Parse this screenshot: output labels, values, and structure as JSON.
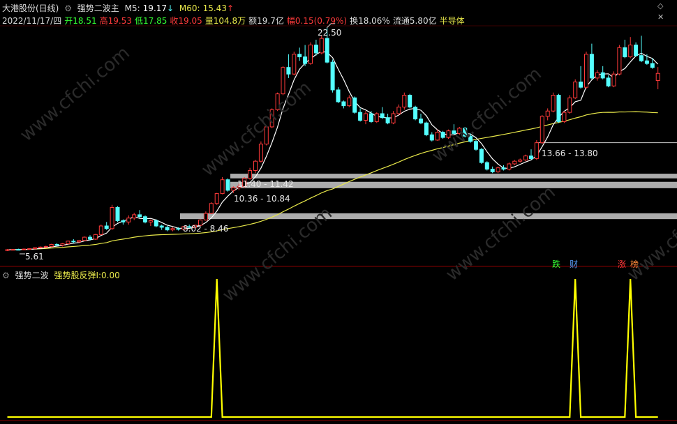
{
  "header": {
    "stock_name": "大港股份(日线)",
    "indicator_name": "强势二波主",
    "m5_label": "M5:",
    "m5_value": "19.17",
    "m5_arrow": "↓",
    "m60_label": "M60:",
    "m60_value": "15.43",
    "m60_arrow": "↑"
  },
  "info": {
    "date": "2022/11/17/四",
    "open_label": "开",
    "open": "18.51",
    "high_label": "高",
    "high": "19.53",
    "low_label": "低",
    "low": "17.85",
    "close_label": "收",
    "close": "19.05",
    "vol_label": "量",
    "vol": "104.8万",
    "amt_label": "额",
    "amt": "19.7亿",
    "chg_label": "幅",
    "chg": "0.15(0.79%)",
    "turn_label": "换",
    "turn": "18.06%",
    "float_label": "流通",
    "float": "5.80亿",
    "sector": "半导体"
  },
  "chart": {
    "high_marker": "22.50",
    "low_marker": "5.61",
    "zones": [
      {
        "label": "13.66 - 13.80"
      },
      {
        "label": "11.40 - 11.42"
      },
      {
        "label": "10.36 - 10.84"
      },
      {
        "label": "8.02 - 8.46"
      }
    ],
    "tags": [
      "跌",
      "财",
      "涨",
      "榜"
    ],
    "watermark": "www.cfchi.com"
  },
  "sub": {
    "name": "强势二波",
    "line_label": "强势股反弹I:",
    "line_value": "0.00"
  },
  "colors": {
    "up": "#ff3a3a",
    "down": "#54ffff",
    "ma5": "#ffffff",
    "ma60": "#e8e84a",
    "signal": "#ffff00"
  },
  "chart_data": {
    "type": "candlestick",
    "ohlc": [
      [
        5.7,
        5.75,
        5.6,
        5.7
      ],
      [
        5.7,
        5.75,
        5.65,
        5.72
      ],
      [
        5.72,
        5.78,
        5.68,
        5.7
      ],
      [
        5.7,
        5.8,
        5.66,
        5.75
      ],
      [
        5.75,
        5.8,
        5.7,
        5.78
      ],
      [
        5.78,
        5.9,
        5.72,
        5.85
      ],
      [
        5.85,
        5.95,
        5.8,
        5.9
      ],
      [
        5.9,
        6.0,
        5.85,
        5.95
      ],
      [
        5.95,
        6.15,
        5.9,
        6.1
      ],
      [
        6.1,
        6.2,
        6.0,
        6.05
      ],
      [
        6.05,
        6.2,
        5.95,
        6.15
      ],
      [
        6.15,
        6.4,
        6.1,
        6.35
      ],
      [
        6.35,
        6.5,
        6.2,
        6.3
      ],
      [
        6.3,
        6.45,
        6.2,
        6.4
      ],
      [
        6.4,
        6.7,
        6.35,
        6.65
      ],
      [
        6.65,
        6.8,
        6.4,
        6.5
      ],
      [
        6.5,
        6.9,
        6.45,
        6.85
      ],
      [
        6.85,
        7.6,
        6.8,
        7.5
      ],
      [
        7.5,
        7.8,
        7.2,
        7.3
      ],
      [
        7.3,
        9.1,
        7.2,
        8.9
      ],
      [
        8.9,
        9.0,
        7.8,
        7.9
      ],
      [
        7.9,
        8.0,
        7.6,
        7.8
      ],
      [
        7.8,
        8.3,
        7.6,
        8.1
      ],
      [
        8.1,
        8.5,
        7.95,
        8.35
      ],
      [
        8.35,
        8.7,
        8.1,
        8.2
      ],
      [
        8.2,
        8.3,
        7.7,
        7.8
      ],
      [
        7.8,
        8.0,
        7.5,
        7.9
      ],
      [
        7.9,
        8.0,
        7.4,
        7.5
      ],
      [
        7.5,
        7.6,
        7.2,
        7.4
      ],
      [
        7.4,
        7.5,
        7.1,
        7.2
      ],
      [
        7.2,
        7.4,
        7.1,
        7.3
      ],
      [
        7.3,
        7.4,
        7.15,
        7.25
      ],
      [
        7.25,
        7.5,
        7.15,
        7.45
      ],
      [
        7.45,
        7.6,
        7.35,
        7.4
      ],
      [
        7.4,
        7.6,
        7.3,
        7.55
      ],
      [
        7.55,
        8.0,
        7.5,
        7.95
      ],
      [
        7.95,
        8.6,
        7.9,
        8.45
      ],
      [
        8.45,
        9.3,
        8.4,
        9.2
      ],
      [
        9.2,
        10.0,
        9.1,
        9.95
      ],
      [
        9.95,
        11.2,
        9.9,
        11.0
      ],
      [
        11.0,
        11.1,
        10.1,
        10.2
      ],
      [
        10.2,
        10.5,
        10.0,
        10.4
      ],
      [
        10.4,
        10.7,
        10.2,
        10.5
      ],
      [
        10.5,
        11.2,
        10.4,
        11.1
      ],
      [
        11.1,
        11.9,
        11.0,
        11.7
      ],
      [
        11.7,
        12.5,
        11.5,
        12.4
      ],
      [
        12.4,
        13.9,
        12.3,
        13.7
      ],
      [
        13.7,
        15.1,
        13.6,
        15.0
      ],
      [
        15.0,
        16.4,
        14.9,
        16.3
      ],
      [
        16.3,
        17.6,
        16.2,
        17.5
      ],
      [
        17.5,
        19.6,
        17.4,
        19.5
      ],
      [
        19.5,
        20.5,
        18.7,
        19.0
      ],
      [
        19.0,
        20.7,
        18.9,
        20.5
      ],
      [
        20.5,
        21.0,
        20.0,
        20.3
      ],
      [
        20.3,
        21.2,
        19.6,
        19.8
      ],
      [
        19.8,
        21.4,
        19.7,
        21.2
      ],
      [
        21.2,
        21.6,
        20.4,
        20.6
      ],
      [
        20.6,
        21.9,
        20.5,
        21.7
      ],
      [
        21.7,
        22.5,
        19.8,
        19.9
      ],
      [
        19.9,
        20.1,
        17.6,
        17.8
      ],
      [
        17.8,
        18.0,
        16.8,
        16.9
      ],
      [
        16.9,
        17.0,
        16.4,
        16.6
      ],
      [
        16.6,
        17.4,
        16.5,
        17.2
      ],
      [
        17.2,
        17.3,
        16.0,
        16.1
      ],
      [
        16.1,
        16.4,
        15.4,
        15.5
      ],
      [
        15.5,
        16.2,
        15.2,
        16.0
      ],
      [
        16.0,
        16.2,
        15.3,
        15.4
      ],
      [
        15.4,
        16.1,
        15.3,
        16.0
      ],
      [
        16.0,
        16.5,
        15.6,
        15.7
      ],
      [
        15.7,
        16.0,
        15.2,
        15.3
      ],
      [
        15.3,
        16.2,
        15.2,
        16.0
      ],
      [
        16.0,
        16.7,
        15.9,
        16.5
      ],
      [
        16.5,
        17.6,
        16.3,
        17.4
      ],
      [
        17.4,
        17.5,
        16.4,
        16.5
      ],
      [
        16.5,
        16.6,
        15.5,
        15.6
      ],
      [
        15.6,
        16.0,
        15.2,
        15.3
      ],
      [
        15.3,
        15.4,
        14.3,
        14.4
      ],
      [
        14.4,
        14.6,
        13.9,
        14.0
      ],
      [
        14.0,
        14.8,
        13.95,
        14.6
      ],
      [
        14.6,
        14.7,
        14.1,
        14.2
      ],
      [
        14.2,
        14.8,
        14.1,
        14.7
      ],
      [
        14.7,
        15.2,
        14.4,
        14.5
      ],
      [
        14.5,
        15.0,
        14.4,
        14.9
      ],
      [
        14.9,
        15.0,
        14.2,
        14.3
      ],
      [
        14.3,
        14.5,
        13.8,
        13.9
      ],
      [
        13.9,
        14.0,
        13.2,
        13.3
      ],
      [
        13.3,
        13.4,
        12.2,
        12.3
      ],
      [
        12.3,
        12.4,
        11.7,
        11.8
      ],
      [
        11.8,
        12.0,
        11.5,
        11.6
      ],
      [
        11.6,
        12.0,
        11.5,
        11.9
      ],
      [
        11.9,
        12.1,
        11.7,
        11.8
      ],
      [
        11.8,
        12.3,
        11.7,
        12.2
      ],
      [
        12.2,
        12.5,
        12.1,
        12.4
      ],
      [
        12.4,
        12.6,
        12.3,
        12.5
      ],
      [
        12.5,
        12.9,
        12.4,
        12.8
      ],
      [
        12.8,
        13.3,
        12.5,
        12.6
      ],
      [
        12.6,
        14.0,
        12.5,
        13.8
      ],
      [
        13.8,
        15.9,
        13.7,
        15.8
      ],
      [
        15.8,
        16.4,
        15.5,
        16.2
      ],
      [
        16.2,
        17.6,
        16.1,
        17.4
      ],
      [
        17.4,
        17.5,
        15.3,
        15.4
      ],
      [
        15.4,
        16.2,
        15.3,
        16.1
      ],
      [
        16.1,
        17.4,
        16.0,
        17.2
      ],
      [
        17.2,
        18.6,
        17.1,
        18.4
      ],
      [
        18.4,
        19.6,
        17.9,
        18.0
      ],
      [
        18.0,
        20.7,
        17.9,
        20.5
      ],
      [
        20.5,
        21.3,
        18.6,
        18.7
      ],
      [
        18.7,
        19.3,
        18.5,
        19.1
      ],
      [
        19.1,
        19.6,
        18.6,
        18.7
      ],
      [
        18.7,
        18.9,
        18.0,
        18.1
      ],
      [
        18.1,
        19.2,
        18.0,
        19.0
      ],
      [
        19.0,
        21.2,
        18.9,
        21.0
      ],
      [
        21.0,
        21.6,
        20.2,
        20.3
      ],
      [
        20.3,
        21.8,
        20.2,
        21.2
      ],
      [
        21.2,
        21.4,
        20.3,
        20.4
      ],
      [
        20.4,
        21.9,
        19.9,
        20.0
      ],
      [
        20.0,
        20.5,
        19.7,
        19.8
      ],
      [
        19.8,
        20.2,
        19.4,
        19.5
      ],
      [
        18.51,
        19.53,
        17.85,
        19.05
      ]
    ],
    "signal_indices": [
      38,
      103,
      113
    ],
    "signal_range": [
      0,
      1
    ]
  }
}
